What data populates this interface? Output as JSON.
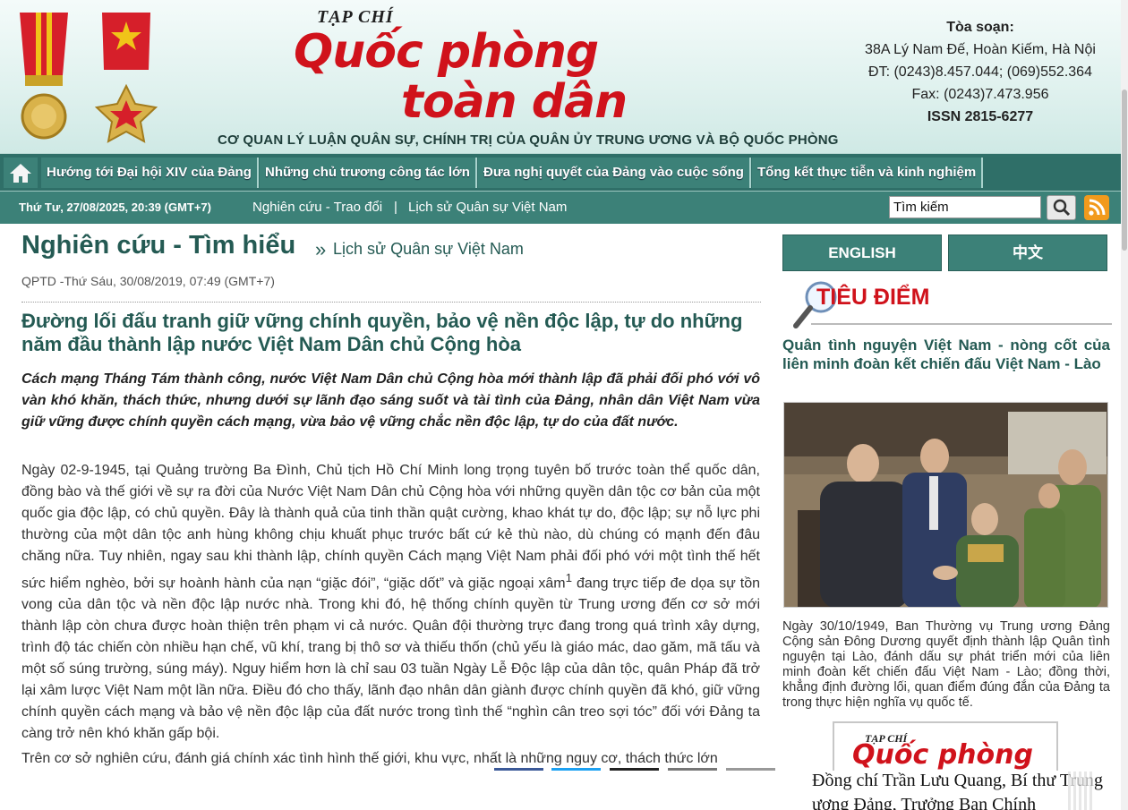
{
  "header": {
    "logo_pre": "TẠP CHÍ",
    "logo_line1": "Quốc phòng",
    "logo_line2": "toàn dân",
    "tagline": "CƠ QUAN LÝ LUẬN QUÂN SỰ, CHÍNH TRỊ CỦA QUÂN ỦY TRUNG ƯƠNG VÀ BỘ QUỐC PHÒNG",
    "contact": {
      "title": "Tòa soạn:",
      "address": "38A Lý Nam Đế, Hoàn Kiếm, Hà Nội",
      "phone": "ĐT: (0243)8.457.044; (069)552.364",
      "fax": "Fax: (0243)7.473.956",
      "issn": "ISSN 2815-6277"
    }
  },
  "nav": {
    "items": [
      {
        "label": "Hướng tới Đại hội XIV của Đảng"
      },
      {
        "label": "Những chủ trương công tác lớn"
      },
      {
        "label": "Đưa nghị quyết của Đảng vào cuộc sống"
      },
      {
        "label": "Tổng kết thực tiễn và kinh nghiệm"
      }
    ]
  },
  "subnav": {
    "date": "Thứ Tư, 27/08/2025, 20:39 (GMT+7)",
    "links": [
      {
        "label": "Nghiên cứu - Trao đổi"
      },
      {
        "label": "Lịch sử Quân sự Việt Nam"
      }
    ],
    "separator": "|",
    "search_value": "Tìm kiếm"
  },
  "article": {
    "category": "Nghiên cứu - Tìm hiểu",
    "arrow": "»",
    "subcategory": "Lịch sử Quân sự Việt Nam",
    "meta": "QPTD -Thứ Sáu, 30/08/2019, 07:49 (GMT+7)",
    "title": "Đường lối đấu tranh giữ vững chính quyền, bảo vệ nền độc lập, tự do những năm đầu thành lập nước Việt Nam Dân chủ Cộng hòa",
    "lead": "Cách mạng Tháng Tám thành công, nước Việt Nam Dân chủ Cộng hòa mới thành lập đã phải đối phó với vô vàn khó khăn, thách thức, nhưng dưới sự lãnh đạo sáng suốt và tài tình của Đảng, nhân dân Việt Nam vừa giữ vững được chính quyền cách mạng, vừa bảo vệ vững chắc nền độc lập, tự do của đất nước.",
    "p1_a": "Ngày 02-9-1945, tại Quảng trường Ba Đình, Chủ tịch Hồ Chí Minh long trọng tuyên bố trước toàn thể quốc dân, đồng bào và thế giới về sự ra đời của Nước Việt Nam Dân chủ Cộng hòa với những quyền dân tộc cơ bản của một quốc gia độc lập, có chủ quyền. Đây là thành quả của tinh thần quật cường, khao khát tự do, độc lập; sự nỗ lực phi thường của một dân tộc anh hùng không chịu khuất phục trước bất cứ kẻ thù nào, dù chúng có mạnh đến đâu chăng nữa. Tuy nhiên, ngay sau khi thành lập, chính quyền Cách mạng Việt Nam phải đối phó với một tình thế hết sức hiểm nghèo, bởi sự hoành hành của nạn “giặc đói”, “giặc dốt” và giặc ngoại xâm",
    "footnote": "1",
    "p1_b": " đang trực tiếp đe dọa sự tồn vong của dân tộc và nền độc lập nước nhà. Trong khi đó, hệ thống chính quyền từ Trung ương đến cơ sở mới thành lập còn chưa được hoàn thiện trên phạm vi cả nước. Quân đội thường trực đang trong quá trình xây dựng, trình độ tác chiến còn nhiều hạn chế, vũ khí, trang bị thô sơ và thiếu thốn (chủ yếu là giáo mác, dao găm, mã tấu và một số súng trường, súng máy). Nguy hiểm hơn là chỉ sau 03 tuần Ngày Lễ Độc lập của dân tộc, quân Pháp đã trở lại xâm lược Việt Nam một lần nữa. Điều đó cho thấy, lãnh đạo nhân dân giành được chính quyền đã khó, giữ vững chính quyền cách mạng và bảo vệ nền độc lập của đất nước trong tình thế “nghìn cân treo sợi tóc” đối với Đảng ta càng trở nên khó khăn gấp bội.",
    "p2": "Trên cơ sở nghiên cứu, đánh giá chính xác tình hình thế giới, khu vực, nhất là những nguy cơ, thách thức lớn"
  },
  "sidebar": {
    "lang_en": "ENGLISH",
    "lang_zh": "中文",
    "focus_title": "TIÊU ĐIỂM",
    "focus_article_title": "Quân tình nguyện Việt Nam - nòng cốt của liên minh đoàn kết chiến đấu Việt Nam - Lào",
    "caption": "Ngày 30/10/1949, Ban Thường vụ Trung ương Đảng Cộng sản Đông Dương quyết định thành lập Quân tình nguyện tại Lào, đánh dấu sự phát triển mới của liên minh đoàn kết chiến đấu Việt Nam - Lào; đồng thời, khẳng định đường lối, quan điểm đúng đắn của Đảng ta trong thực hiện nghĩa vụ quốc tế.",
    "logo_pre": "TẠP CHÍ",
    "logo_line1": "Quốc phòng"
  },
  "popup": {
    "text": "Đồng chí Trần Lưu Quang, Bí thư Trung ương Đảng, Trưởng Ban Chính"
  },
  "colors": {
    "brand_red": "#d0121b",
    "teal_dark": "#2f6f68",
    "teal": "#3c8178",
    "heading": "#245a53"
  }
}
